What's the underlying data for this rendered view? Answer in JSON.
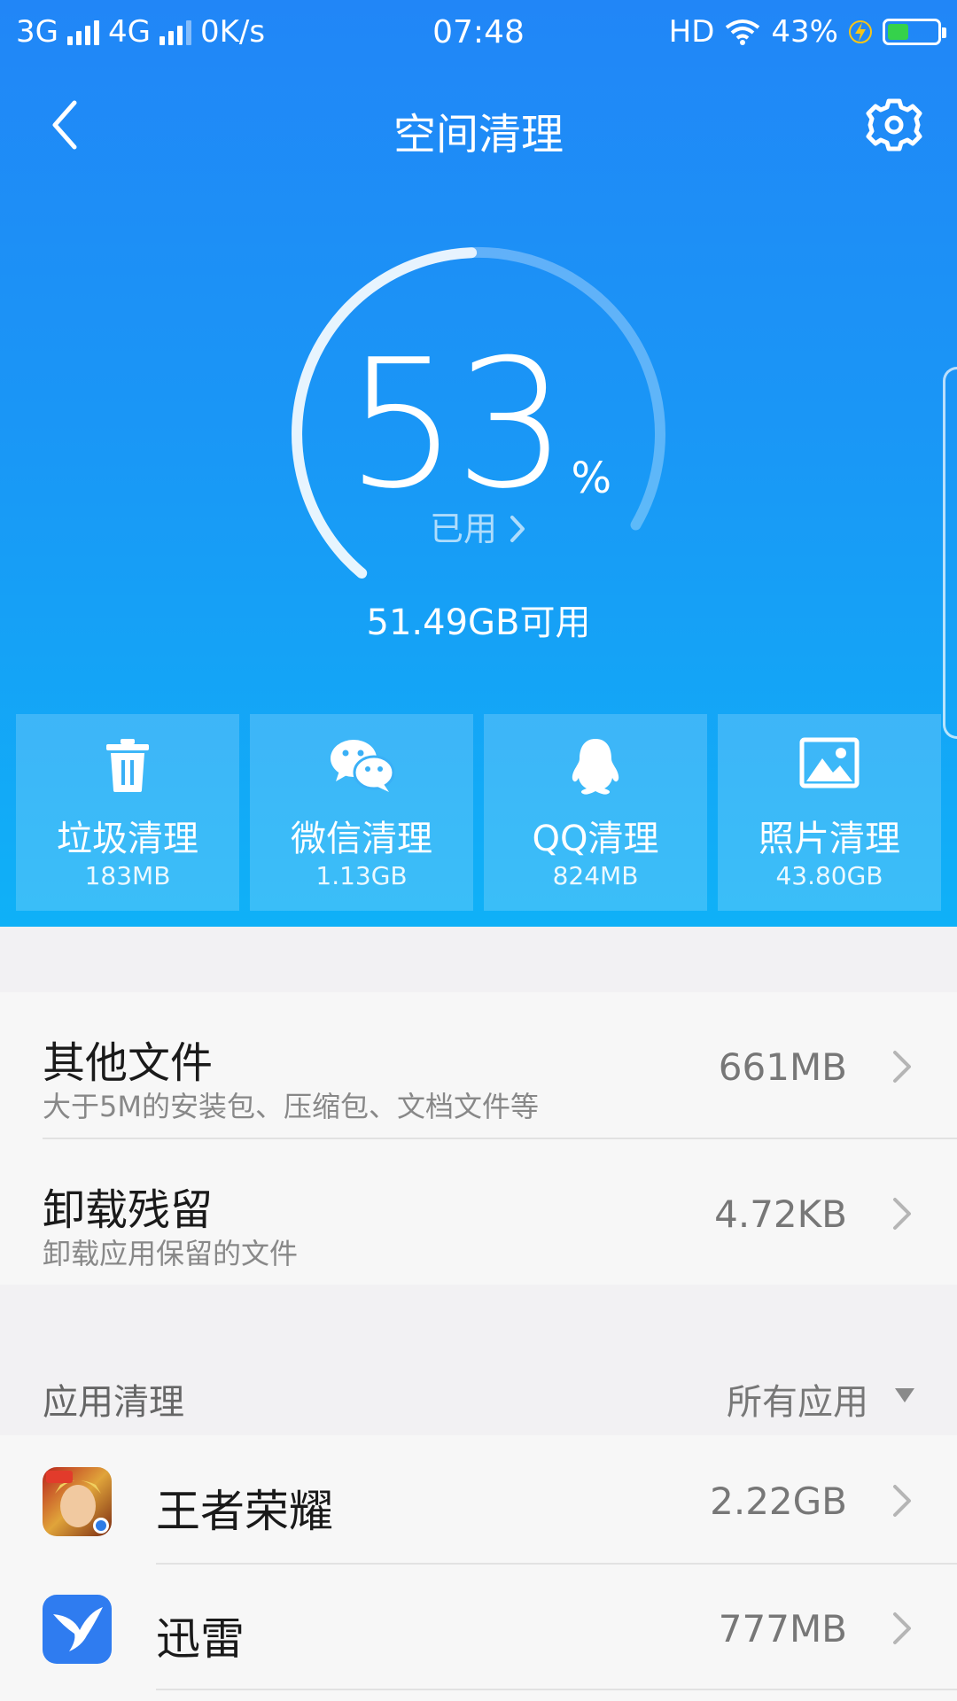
{
  "status_bar": {
    "network1": "3G",
    "network2": "4G",
    "speed": "0K/s",
    "time": "07:48",
    "hd": "HD",
    "battery_pct": "43%",
    "battery_level": 0.43
  },
  "header": {
    "title": "空间清理"
  },
  "storage": {
    "used_percent": "53",
    "percent_sign": "%",
    "used_label": "已用",
    "available": "51.49GB可用",
    "used_fraction": 0.53
  },
  "cards": [
    {
      "label": "垃圾清理",
      "size": "183MB",
      "icon": "trash-icon"
    },
    {
      "label": "微信清理",
      "size": "1.13GB",
      "icon": "wechat-icon"
    },
    {
      "label": "QQ清理",
      "size": "824MB",
      "icon": "qq-penguin-icon"
    },
    {
      "label": "照片清理",
      "size": "43.80GB",
      "icon": "photo-icon"
    }
  ],
  "file_items": [
    {
      "title": "其他文件",
      "subtitle": "大于5M的安装包、压缩包、文档文件等",
      "value": "661MB"
    },
    {
      "title": "卸载残留",
      "subtitle": "卸载应用保留的文件",
      "value": "4.72KB"
    }
  ],
  "app_section": {
    "label": "应用清理",
    "filter": "所有应用"
  },
  "apps": [
    {
      "name": "王者荣耀",
      "size": "2.22GB",
      "icon": "honor-of-kings-icon"
    },
    {
      "name": "迅雷",
      "size": "777MB",
      "icon": "xunlei-icon"
    }
  ],
  "colors": {
    "hero_top": "#2186f7",
    "hero_bottom": "#0fb1f7",
    "battery_fill": "#35d24b"
  }
}
